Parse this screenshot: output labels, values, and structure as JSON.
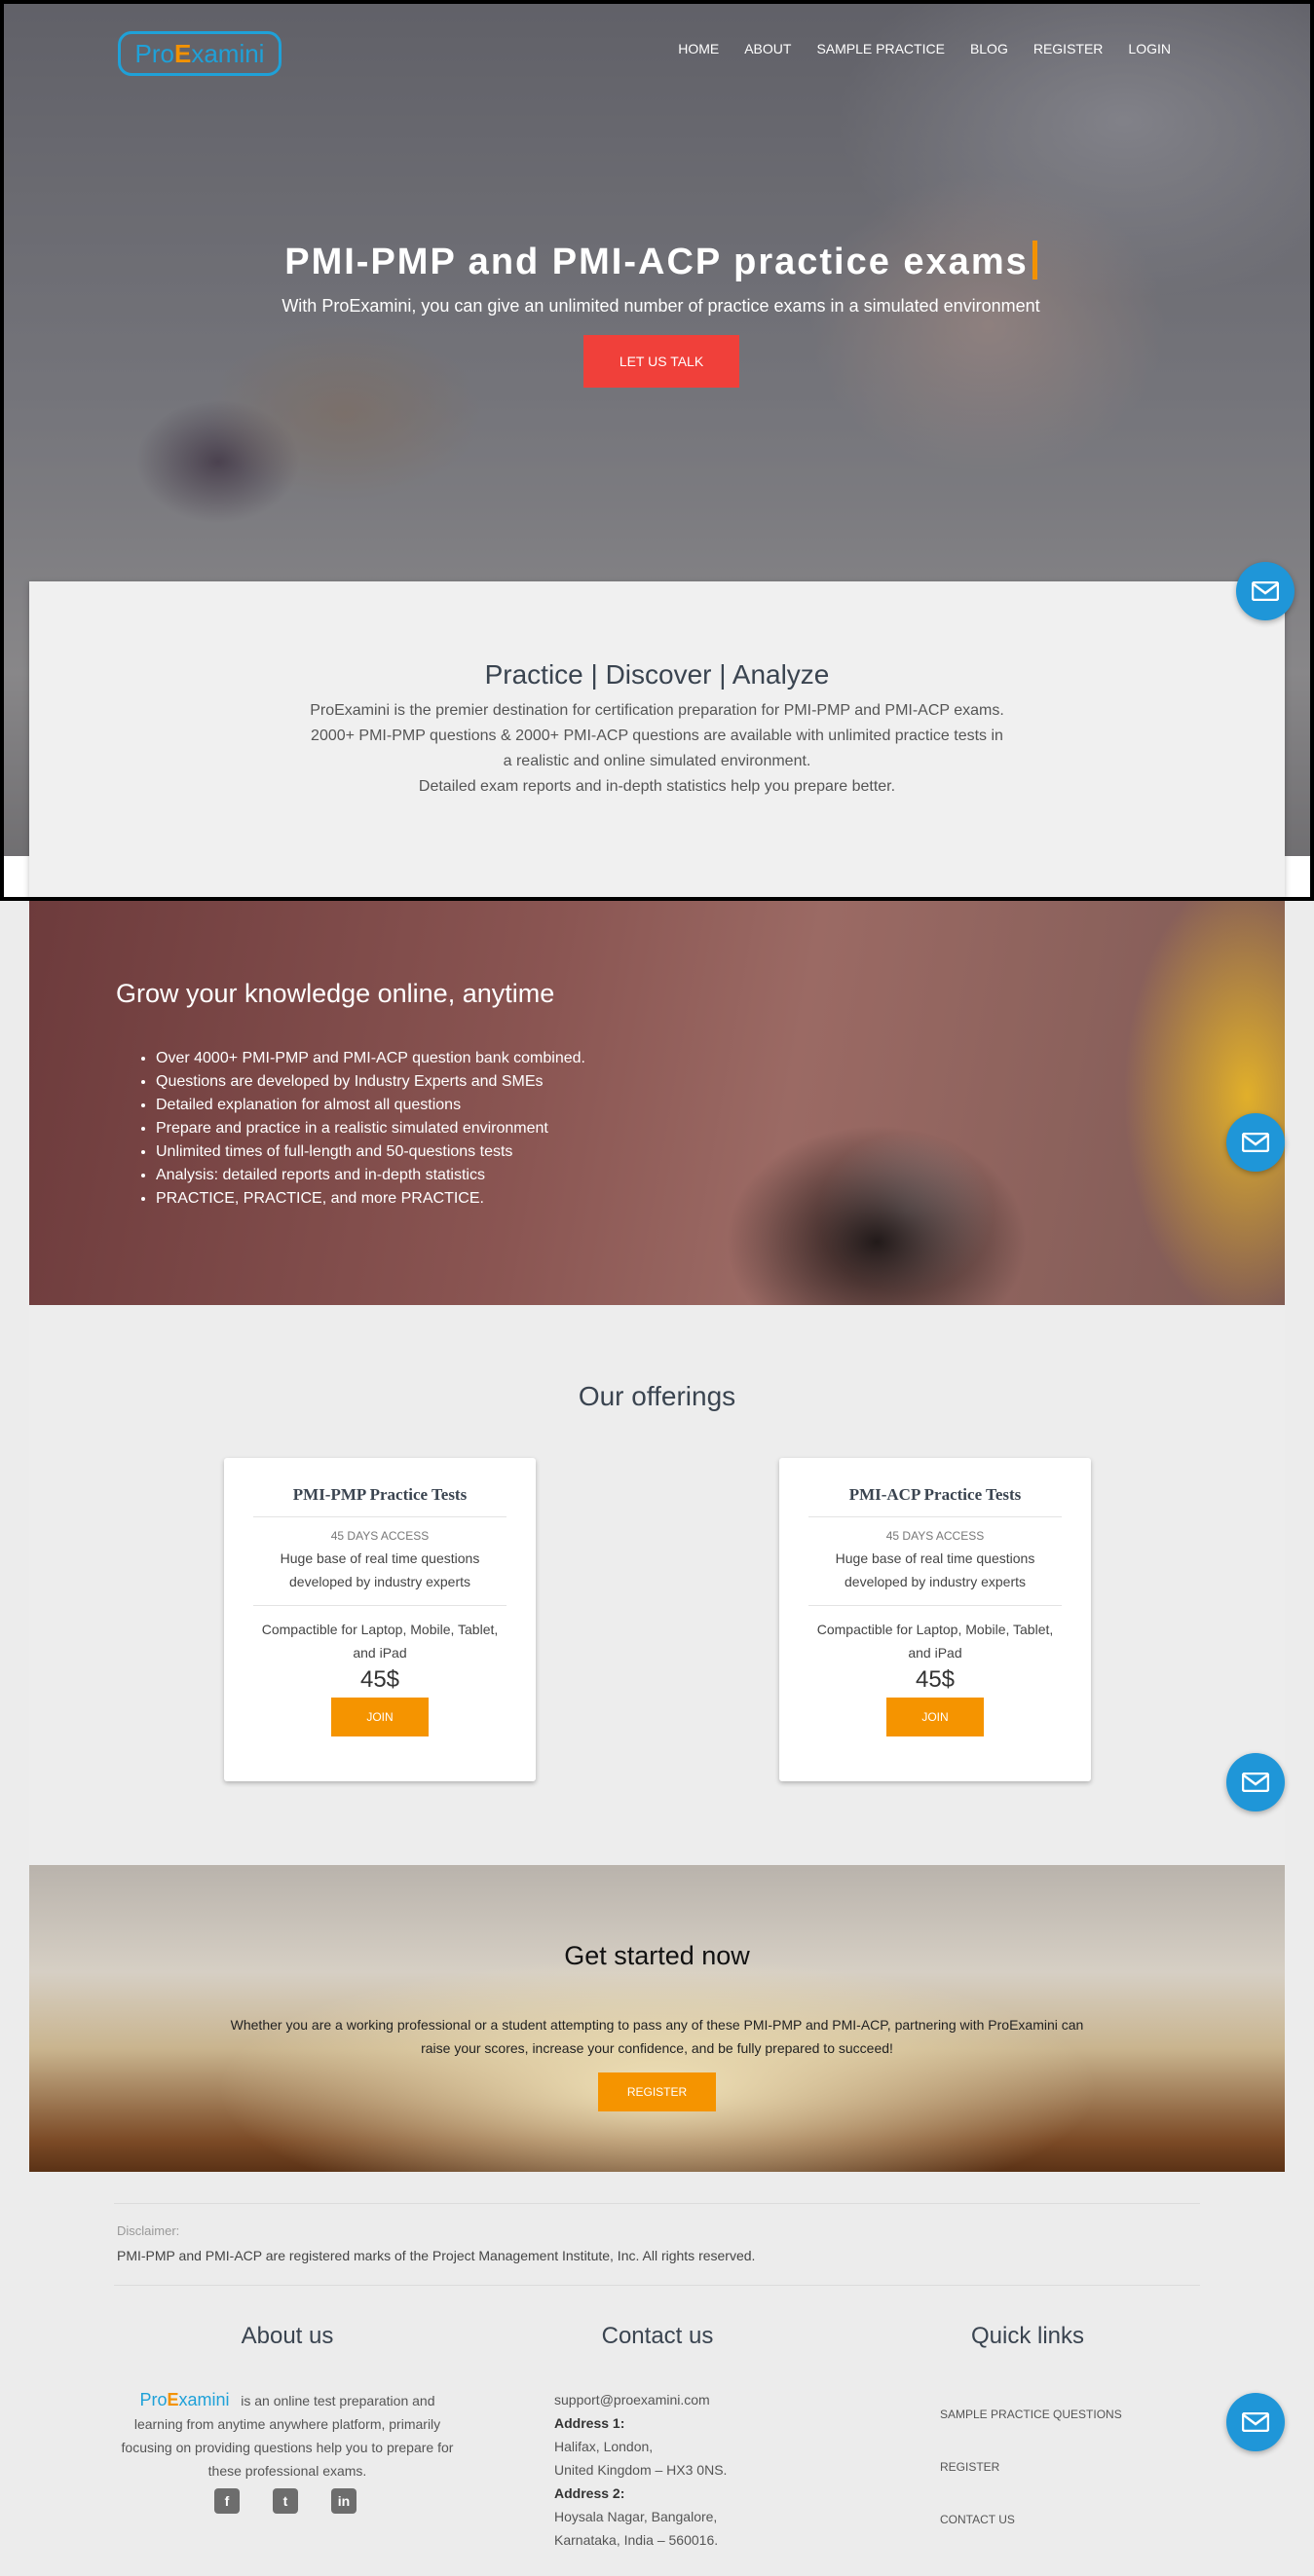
{
  "brand": {
    "name_prefix": "Pro",
    "name_cap": "E",
    "name_suffix": "xamini"
  },
  "nav": [
    "HOME",
    "ABOUT",
    "SAMPLE PRACTICE",
    "BLOG",
    "REGISTER",
    "LOGIN"
  ],
  "hero": {
    "title": "PMI-PMP and PMI-ACP practice exams",
    "subtitle": "With ProExamini, you can give an unlimited number of practice exams in a simulated environment",
    "cta": "LET US TALK"
  },
  "intro": {
    "title": "Practice | Discover | Analyze",
    "lines": [
      "ProExamini is the premier destination for certification preparation for PMI-PMP and PMI-ACP exams.",
      "2000+ PMI-PMP questions & 2000+ PMI-ACP questions are available with unlimited practice tests in a realistic and online simulated environment.",
      "Detailed exam reports and in-depth statistics help you prepare better."
    ]
  },
  "knowledge": {
    "title": "Grow your knowledge online, anytime",
    "items": [
      "Over 4000+ PMI-PMP and PMI-ACP question bank combined.",
      "Questions are developed by Industry Experts and SMEs",
      "Detailed explanation for almost all questions",
      "Prepare and practice in a realistic simulated environment",
      "Unlimited times of full-length and 50-questions tests",
      "Analysis: detailed reports and in-depth statistics",
      "PRACTICE, PRACTICE, and more PRACTICE."
    ]
  },
  "offerings": {
    "title": "Our offerings",
    "cards": [
      {
        "title": "PMI-PMP Practice Tests",
        "access": "45 DAYS ACCESS",
        "desc1": "Huge base of real time questions developed by industry experts",
        "desc2": "Compactible for Laptop, Mobile, Tablet, and iPad",
        "price": "45$",
        "cta": "JOIN"
      },
      {
        "title": "PMI-ACP Practice Tests",
        "access": "45 DAYS ACCESS",
        "desc1": "Huge base of real time questions developed by industry experts",
        "desc2": "Compactible for Laptop, Mobile, Tablet, and iPad",
        "price": "45$",
        "cta": "JOIN"
      }
    ]
  },
  "started": {
    "title": "Get started now",
    "text": "Whether you are a working professional or a student attempting to pass any of these PMI-PMP and PMI-ACP, partnering with ProExamini can raise your scores, increase your confidence, and be fully prepared to succeed!",
    "cta": "REGISTER"
  },
  "footer": {
    "disclaimer_label": "Disclaimer:",
    "disclaimer_text": "PMI-PMP and PMI-ACP are registered marks of the Project Management Institute, Inc. All rights reserved.",
    "about_title": "About us",
    "about_text": "is an online test preparation and learning from anytime anywhere platform, primarily focusing on providing questions help you to prepare for these professional exams.",
    "contact_title": "Contact us",
    "email": "support@proexamini.com",
    "address1_label": "Address 1:",
    "address1_line1": "Halifax, London,",
    "address1_line2": "United Kingdom – HX3 0NS.",
    "address2_label": "Address 2:",
    "address2_line1": "Hoysala Nagar, Bangalore,",
    "address2_line2": "Karnataka, India – 560016.",
    "quick_title": "Quick links",
    "quick_links": [
      "SAMPLE PRACTICE QUESTIONS",
      "REGISTER",
      "CONTACT US"
    ],
    "social": [
      "f",
      "t",
      "in"
    ]
  },
  "icons": {
    "mail": "mail-icon",
    "facebook": "facebook-icon",
    "twitter": "twitter-icon",
    "linkedin": "linkedin-icon"
  },
  "colors": {
    "accent_blue": "#1f96d8",
    "accent_orange": "#f59400",
    "cta_red": "#f0403a"
  }
}
